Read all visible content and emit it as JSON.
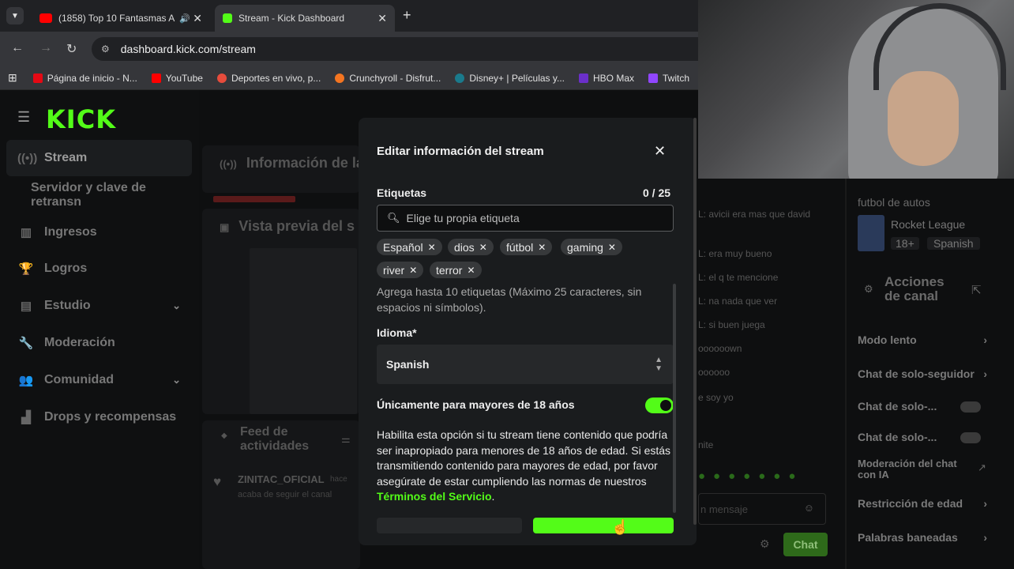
{
  "browser": {
    "tabs": [
      {
        "label": "(1858) Top 10 Fantasmas A"
      },
      {
        "label": "Stream - Kick Dashboard"
      }
    ],
    "url": "dashboard.kick.com/stream",
    "bookmarks": [
      "Página de inicio - N...",
      "YouTube",
      "Deportes en vivo, p...",
      "Crunchyroll - Disfrut...",
      "Disney+ | Películas y...",
      "HBO Max",
      "Twitch"
    ]
  },
  "sidebar": {
    "logo": "KICK",
    "items": [
      {
        "label": "Stream"
      },
      {
        "label": "Servidor y clave de retransn"
      },
      {
        "label": "Ingresos"
      },
      {
        "label": "Logros"
      },
      {
        "label": "Estudio"
      },
      {
        "label": "Moderación"
      },
      {
        "label": "Comunidad"
      },
      {
        "label": "Drops y recompensas"
      }
    ]
  },
  "background": {
    "info_title": "Información de la",
    "preview_title": "Vista previa del s",
    "feed_title": "Feed de actividades",
    "feed_user": "ZINITAC_OFICIAL",
    "feed_action": "hace",
    "feed_line2": "acaba de seguir el canal"
  },
  "modal": {
    "title": "Editar información del stream",
    "tags_label": "Etiquetas",
    "tags_count": "0 / 25",
    "tag_placeholder": "Elige tu propia etiqueta",
    "tags": [
      "Español",
      "dios",
      "fútbol",
      "gaming",
      "river",
      "terror"
    ],
    "tags_help": "Agrega hasta 10 etiquetas (Máximo 25 caracteres, sin espacios ni símbolos).",
    "language_label": "Idioma*",
    "language_value": "Spanish",
    "age_label": "Únicamente para mayores de 18 años",
    "age_enabled": true,
    "age_desc": "Habilita esta opción si tu stream tiene contenido que podría ser inapropiado para menores de 18 años de edad. Si estás transmitiendo contenido para mayores de edad, por favor asegúrate de estar cumpliendo las normas de nuestros",
    "terms_link": "Términos del Servicio",
    "terms_end": "."
  },
  "right_panel": {
    "category_title": "futbol de autos",
    "category": "Rocket League",
    "badges": [
      "18+",
      "Spanish"
    ],
    "actions_title": "Acciones de canal",
    "actions": [
      "Modo lento",
      "Chat de solo-seguidor",
      "Chat de solo-...",
      "Chat de solo-...",
      "Moderación del chat con IA",
      "Restricción de edad",
      "Palabras baneadas"
    ],
    "chat_lines": [
      "L: avicii era mas que david",
      "L: era muy bueno",
      "L: el q te mencione",
      "L: na nada que ver",
      "L: si buen juega",
      "oooooown",
      "oooooo",
      "e soy yo",
      "nite"
    ],
    "chat_placeholder": "n mensaje",
    "chat_button": "Chat"
  },
  "colors": {
    "accent": "#53fc18"
  }
}
